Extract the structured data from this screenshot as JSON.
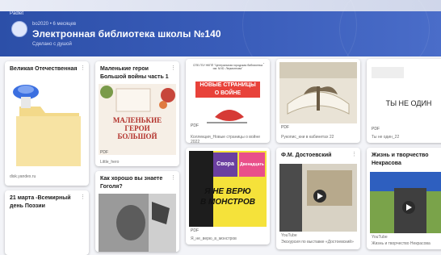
{
  "header": {
    "brand": "Padlet",
    "meta": "bo2020 • 6 месяцев",
    "title": "Электронная библиотека школы №140",
    "subtitle": "Сделано с душой"
  },
  "cards": {
    "c1": {
      "title": "Великая Отечественная",
      "caption": "disk.yandex.ru"
    },
    "c2": {
      "title": "21 марта -Всемирный день Поэзии"
    },
    "c3": {
      "title": "Маленькие герои Большой войны часть 1",
      "book_line1": "МАЛЕНЬКИЕ",
      "book_line2": "ГЕРОИ",
      "book_line3": "БОЛЬШОЙ",
      "pdf": "PDF",
      "caption": "Little_hero"
    },
    "c4": {
      "title": "Как хорошо вы знаете Гоголя?"
    },
    "c5": {
      "header_text": "СПБ ГБУ НКПП \"Центральная городская библиотека им. М.Ю. Лермонтова\"",
      "book_line1": "НОВЫЕ СТРАНИЦЫ",
      "book_line2": "О ВОЙНЕ",
      "pdf": "PDF",
      "caption": "Коллекция_Новые страницы о войне 2022"
    },
    "c6": {
      "line1": "Я НЕ ВЕРЮ",
      "line2": "В МОНСТРОВ",
      "tag1": "Свора",
      "tag2": "Двенадцать",
      "pdf": "PDF",
      "caption": "Я_не_верю_в_монстров"
    },
    "c7": {
      "pdf": "PDF",
      "caption": "Рукопис_кни в кабинетах 22"
    },
    "c8": {
      "title": "Ф.М. Достоевский",
      "source": "YouTube",
      "caption": "Экскурсия по выставке «Достоевский»"
    },
    "c9": {
      "text": "ТЫ НЕ ОДИН",
      "pdf": "PDF",
      "caption": "Ты не один_22"
    },
    "c10": {
      "title": "Жизнь и творчество Некрасова",
      "source": "YouTube",
      "caption": "Жизнь и творчество Некрасова"
    }
  },
  "colors": {
    "header": "#2c4fa8",
    "accent_red": "#c9302c",
    "accent_yellow": "#f5e23a"
  }
}
